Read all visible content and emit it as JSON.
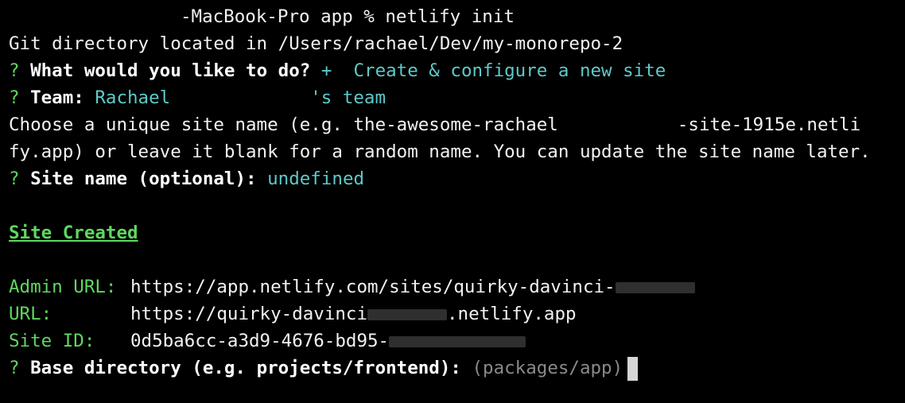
{
  "terminal": {
    "prompt_host_suffix": "-MacBook-Pro app % ",
    "command": "netlify init",
    "git_dir_line": "Git directory located in /Users/rachael/Dev/my-monorepo-2",
    "q_mark": "?",
    "q1": {
      "label": "What would you like to do?",
      "answer": "+  Create & configure a new site"
    },
    "q2": {
      "label": "Team:",
      "answer_start": "Rachael",
      "answer_end": "'s team"
    },
    "choose_line_1_start": "Choose a unique site name (e.g. the-awesome-rachael",
    "choose_line_1_end": "-site-1915e.netli",
    "choose_line_2": "fy.app) or leave it blank for a random name. You can update the site name later.",
    "q3": {
      "label": "Site name (optional):",
      "answer": "undefined"
    },
    "site_created": "Site Created",
    "admin_url_label": "Admin URL:",
    "admin_url_value": "https://app.netlify.com/sites/quirky-davinci-",
    "url_label": "URL:",
    "url_value_start": "https://quirky-davinci",
    "url_value_end": ".netlify.app",
    "site_id_label": "Site ID:",
    "site_id_value": "0d5ba6cc-a3d9-4676-bd95-",
    "q4": {
      "label": "Base directory (e.g. projects/frontend):",
      "default": "(packages/app)"
    }
  },
  "colors": {
    "background": "#000000",
    "text": "#f2f2f2",
    "green": "#5fd75f",
    "cyan": "#5fc9c9",
    "grey": "#8a8a8a",
    "cursor": "#d6d6d6"
  }
}
